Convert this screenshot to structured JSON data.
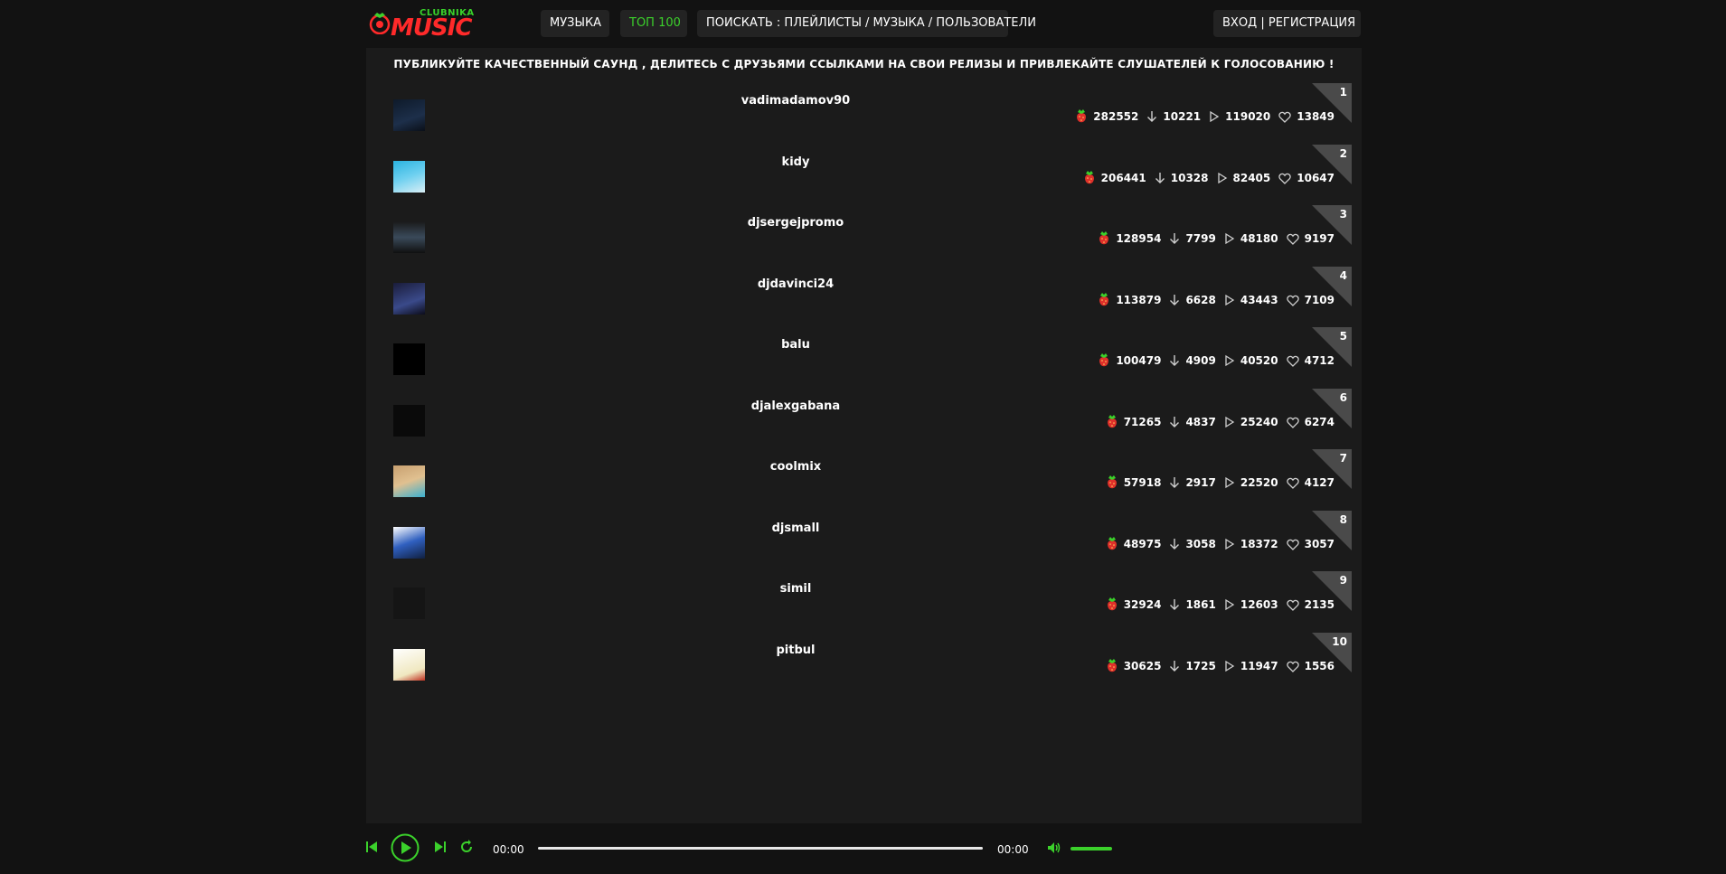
{
  "header": {
    "logo_top": "CLUBNIKA",
    "logo_main": "MUSIC",
    "nav": [
      {
        "label": "МУЗЫКА"
      },
      {
        "label": "ТОП 100"
      },
      {
        "label": "ПОИСКАТЬ : ПЛЕЙЛИСТЫ / МУЗЫКА / ПОЛЬЗОВАТЕЛИ"
      }
    ],
    "auth_label": "ВХОД | РЕГИСТРАЦИЯ"
  },
  "banner": "ПУБЛИКУЙТЕ КАЧЕСТВЕННЫЙ САУНД , ДЕЛИТЕСЬ С ДРУЗЬЯМИ ССЫЛКАМИ НА СВОИ РЕЛИЗЫ И ПРИВЛЕКАЙТЕ СЛУШАТЕЛЕЙ К ГОЛОСОВАНИЮ !",
  "colors": {
    "accent": "#3bd12b",
    "brand_red": "#ff2a2a",
    "panel": "#1b1b1b",
    "bg": "#121212"
  },
  "rows": [
    {
      "rank": "1",
      "username": "vadimadamov90",
      "berries": "282552",
      "downloads": "10221",
      "plays": "119020",
      "likes": "13849"
    },
    {
      "rank": "2",
      "username": "kidy",
      "berries": "206441",
      "downloads": "10328",
      "plays": "82405",
      "likes": "10647"
    },
    {
      "rank": "3",
      "username": "djsergejpromo",
      "berries": "128954",
      "downloads": "7799",
      "plays": "48180",
      "likes": "9197"
    },
    {
      "rank": "4",
      "username": "djdavinci24",
      "berries": "113879",
      "downloads": "6628",
      "plays": "43443",
      "likes": "7109"
    },
    {
      "rank": "5",
      "username": "balu",
      "berries": "100479",
      "downloads": "4909",
      "plays": "40520",
      "likes": "4712"
    },
    {
      "rank": "6",
      "username": "djalexgabana",
      "berries": "71265",
      "downloads": "4837",
      "plays": "25240",
      "likes": "6274"
    },
    {
      "rank": "7",
      "username": "coolmix",
      "berries": "57918",
      "downloads": "2917",
      "plays": "22520",
      "likes": "4127"
    },
    {
      "rank": "8",
      "username": "djsmall",
      "berries": "48975",
      "downloads": "3058",
      "plays": "18372",
      "likes": "3057"
    },
    {
      "rank": "9",
      "username": "simil",
      "berries": "32924",
      "downloads": "1861",
      "plays": "12603",
      "likes": "2135"
    },
    {
      "rank": "10",
      "username": "pitbul",
      "berries": "30625",
      "downloads": "1725",
      "plays": "11947",
      "likes": "1556"
    }
  ],
  "player": {
    "time_current": "00:00",
    "time_total": "00:00"
  }
}
